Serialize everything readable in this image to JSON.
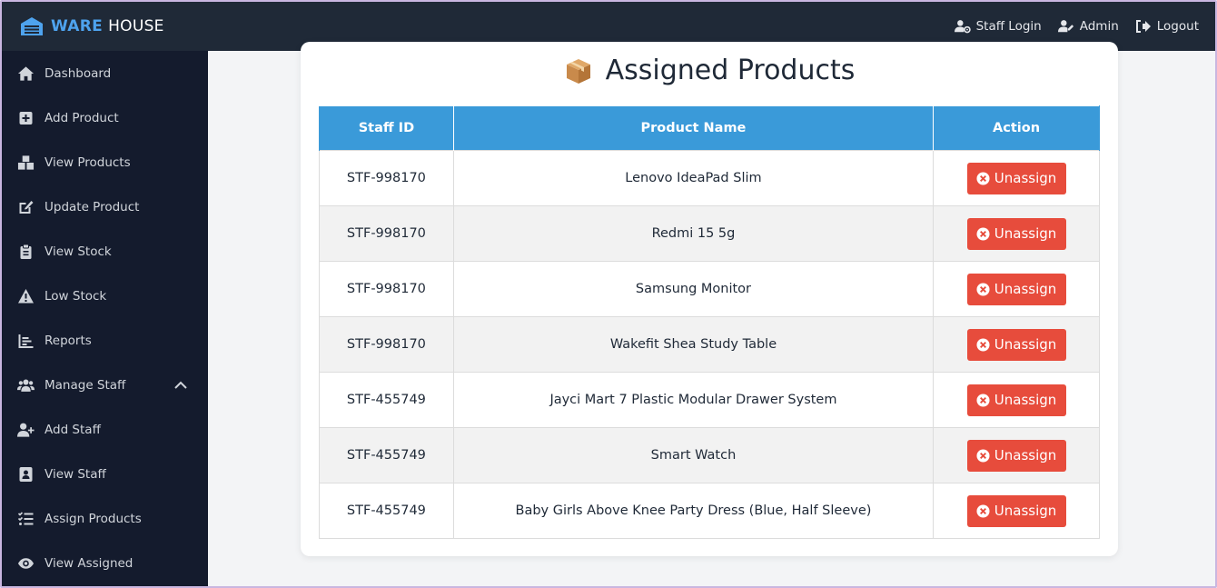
{
  "brand": {
    "part1": "WARE",
    "part2": "HOUSE"
  },
  "topnav": [
    {
      "label": "Staff Login",
      "icon": "user-cog-icon"
    },
    {
      "label": "Admin",
      "icon": "user-edit-icon"
    },
    {
      "label": "Logout",
      "icon": "logout-icon"
    }
  ],
  "sidebar": {
    "items": [
      {
        "label": "Dashboard",
        "icon": "home-icon"
      },
      {
        "label": "Add Product",
        "icon": "plus-square-icon"
      },
      {
        "label": "View Products",
        "icon": "boxes-icon"
      },
      {
        "label": "Update Product",
        "icon": "edit-icon"
      },
      {
        "label": "View Stock",
        "icon": "clipboard-icon"
      },
      {
        "label": "Low Stock",
        "icon": "warning-icon"
      },
      {
        "label": "Reports",
        "icon": "chart-icon"
      },
      {
        "label": "Manage Staff",
        "icon": "users-icon",
        "expanded": true
      },
      {
        "label": "Add Staff",
        "icon": "user-plus-icon"
      },
      {
        "label": "View Staff",
        "icon": "id-badge-icon"
      },
      {
        "label": "Assign Products",
        "icon": "tasks-icon"
      },
      {
        "label": "View Assigned",
        "icon": "eye-icon"
      }
    ]
  },
  "page": {
    "title": "Assigned Products",
    "title_icon": "package-icon"
  },
  "table": {
    "headers": [
      "Staff ID",
      "Product Name",
      "Action"
    ],
    "rows": [
      {
        "staff_id": "STF-998170",
        "product": "Lenovo IdeaPad Slim",
        "action": "Unassign"
      },
      {
        "staff_id": "STF-998170",
        "product": "Redmi 15 5g",
        "action": "Unassign"
      },
      {
        "staff_id": "STF-998170",
        "product": "Samsung Monitor",
        "action": "Unassign"
      },
      {
        "staff_id": "STF-998170",
        "product": "Wakefit Shea Study Table",
        "action": "Unassign"
      },
      {
        "staff_id": "STF-455749",
        "product": "Jayci Mart 7 Plastic Modular Drawer System",
        "action": "Unassign"
      },
      {
        "staff_id": "STF-455749",
        "product": "Smart Watch",
        "action": "Unassign"
      },
      {
        "staff_id": "STF-455749",
        "product": "Baby Girls Above Knee Party Dress (Blue, Half Sleeve)",
        "action": "Unassign"
      }
    ]
  },
  "colors": {
    "topbar": "#1f2937",
    "sidebar": "#141b2d",
    "brand_accent": "#4ea3ee",
    "table_header": "#3a9ad9",
    "danger": "#e74c3c"
  }
}
